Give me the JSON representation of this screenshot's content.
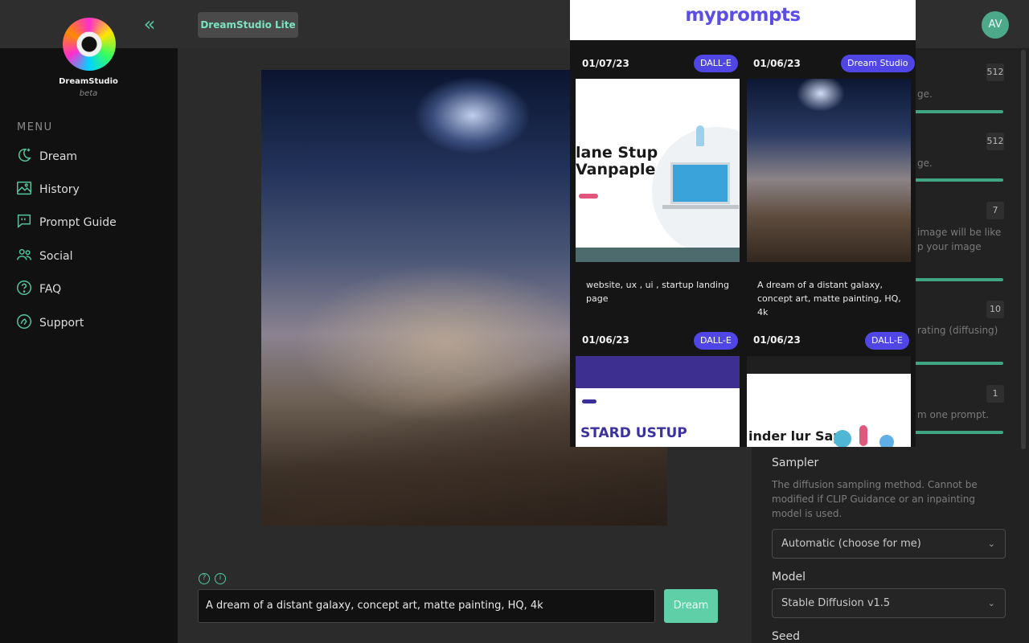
{
  "app": {
    "logo_name": "DreamStudio",
    "logo_subtitle": "beta",
    "brand_button": "DreamStudio Lite",
    "avatar_initials": "AV"
  },
  "sidebar": {
    "menu_heading": "MENU",
    "items": [
      {
        "label": "Dream",
        "icon": "moon-stars-icon"
      },
      {
        "label": "History",
        "icon": "image-icon"
      },
      {
        "label": "Prompt Guide",
        "icon": "quote-bubble-icon"
      },
      {
        "label": "Social",
        "icon": "people-icon"
      },
      {
        "label": "FAQ",
        "icon": "question-circle-icon"
      },
      {
        "label": "Support",
        "icon": "support-icon"
      }
    ]
  },
  "prompt": {
    "value": "A dream of a distant galaxy, concept art, matte painting, HQ, 4k",
    "dream_button": "Dream"
  },
  "settings": {
    "values": [
      "512",
      "512",
      "7",
      "10",
      "1"
    ],
    "partial_texts": [
      "ge.",
      "ge.",
      "image will be like",
      "p your image",
      "rating (diffusing)",
      "m one prompt."
    ],
    "sampler_label": "Sampler",
    "sampler_desc": "The diffusion sampling method. Cannot be modified if CLIP Guidance or an inpainting model is used.",
    "sampler_value": "Automatic (choose for me)",
    "model_label": "Model",
    "model_value": "Stable Diffusion v1.5",
    "seed_label": "Seed"
  },
  "overlay": {
    "title": "myprompts",
    "cards": [
      {
        "date": "01/07/23",
        "badge": "DALL-E",
        "caption": "website, ux , ui , startup landing page",
        "thumb_text": "lane Stup Vanpaple"
      },
      {
        "date": "01/06/23",
        "badge": "Dream Studio",
        "caption": "A dream of a distant galaxy, concept art, matte painting, HQ, 4k",
        "thumb_text": ""
      },
      {
        "date": "01/06/23",
        "badge": "DALL-E",
        "caption": "",
        "thumb_text": "STARD USTUP"
      },
      {
        "date": "01/06/23",
        "badge": "DALL-E",
        "caption": "",
        "thumb_text": "inder lur Sap"
      }
    ]
  },
  "colors": {
    "accent": "#52c7a0",
    "badge": "#4f46e5",
    "overlay_title": "#5b4ee6"
  }
}
